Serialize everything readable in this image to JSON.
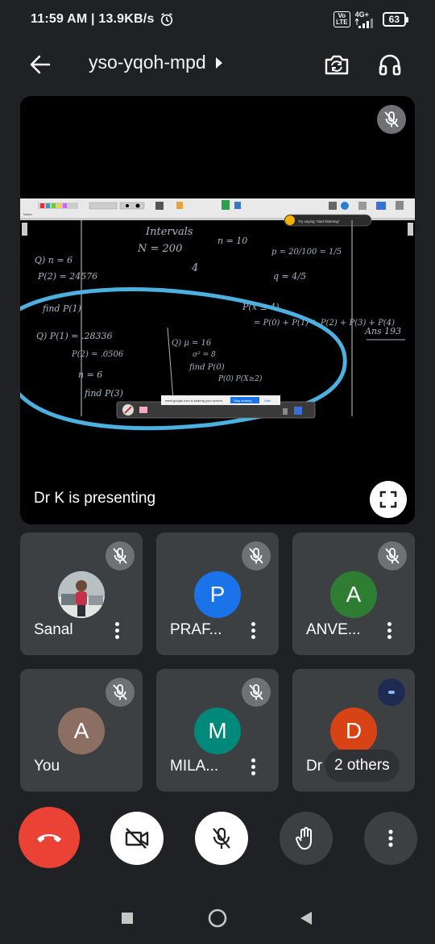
{
  "status_bar": {
    "time": "11:59 AM",
    "net_speed": "13.9KB/s",
    "volte_label": "Vo LTE",
    "network_type": "4G+",
    "battery": "63"
  },
  "header": {
    "meeting_code": "yso-yqoh-mpd"
  },
  "presentation": {
    "presenting_text": "Dr K is presenting",
    "share_bar_text": "meet.google.com is sharing your screen.",
    "stop_sharing_label": "Stop sharing",
    "hide_label": "Hide",
    "listening_hint": "Try saying \"start listening\"",
    "whiteboard_text": {
      "line_intervals": "Intervals",
      "line_n200": "N = 200",
      "line_n10": "n = 10",
      "line_4": "4",
      "q1": "Q) n = 6",
      "q1_p2": "P(2) = 24576",
      "q1_find": "find P(1)",
      "p_value": "p = 20/100 = 1/5",
      "q_value": "q = 4/5",
      "p_le4": "P(x ≤ 4)",
      "sum": "= P(0) + P(1) + P(2) + P(3) + P(4)",
      "ans": "Ans 193",
      "q2": "Q) P(1) = .28336",
      "q2_p2": "P(2) = .0506",
      "q2_n": "n = 6",
      "q2_find": "find P(3)",
      "q3": "Q) μ = 16",
      "q3_sigma": "σ² = 8",
      "q3_find": "find P(0)",
      "q3_p": "P(0) P(X≥2)"
    }
  },
  "participants": [
    {
      "name": "Sanal",
      "initial": "",
      "color": "#5f6368",
      "muted": true,
      "has_photo": true
    },
    {
      "name": "PRAF...",
      "initial": "P",
      "color": "#1a73e8",
      "muted": true
    },
    {
      "name": "ANVE...",
      "initial": "A",
      "color": "#2e7d32",
      "muted": true
    },
    {
      "name": "You",
      "initial": "A",
      "color": "#8d6e63",
      "muted": true
    },
    {
      "name": "MILA...",
      "initial": "M",
      "color": "#00897b",
      "muted": true
    },
    {
      "name": "Dr K",
      "initial": "D",
      "color": "#d84315",
      "muted": false,
      "others_label": "2 others"
    }
  ],
  "controls": {
    "hangup_icon": "phone-hangup-icon",
    "camera_icon": "camera-off-icon",
    "mic_icon": "mic-off-icon",
    "raise_hand_icon": "hand-icon",
    "more_icon": "more-vert-icon"
  },
  "nav": {
    "recent": "square-icon",
    "home": "circle-icon",
    "back": "triangle-icon"
  }
}
